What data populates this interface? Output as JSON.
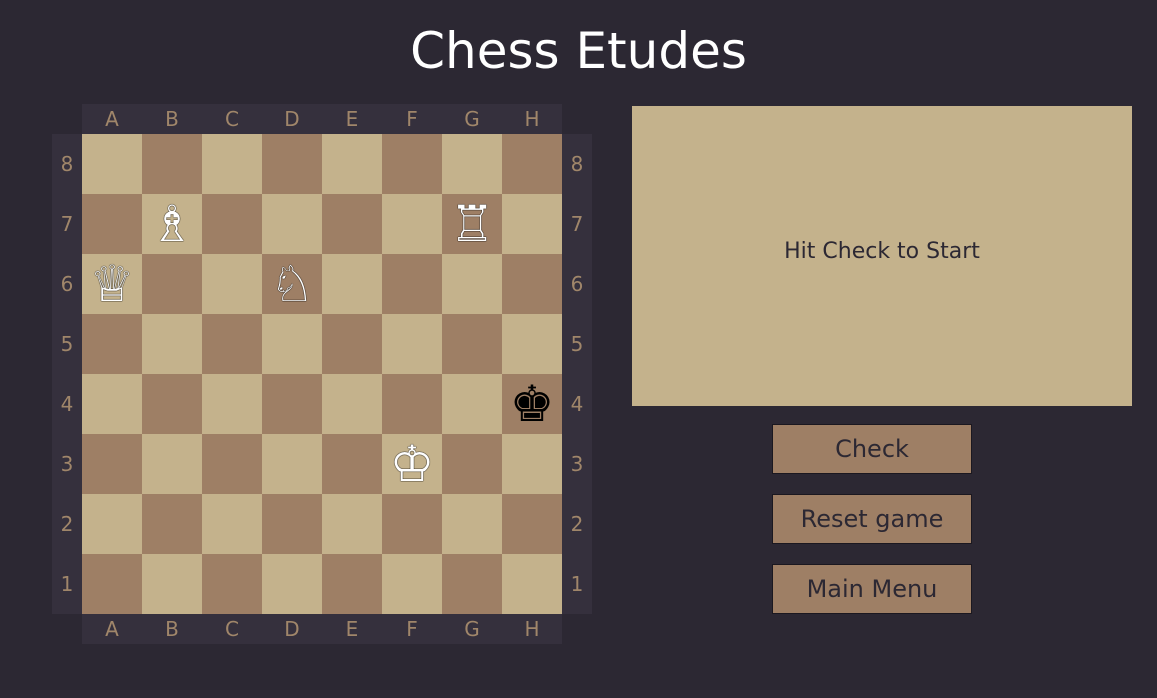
{
  "title": "Chess Etudes",
  "board": {
    "files": [
      "A",
      "B",
      "C",
      "D",
      "E",
      "F",
      "G",
      "H"
    ],
    "ranks": [
      "8",
      "7",
      "6",
      "5",
      "4",
      "3",
      "2",
      "1"
    ],
    "light_color": "#c4b28c",
    "dark_color": "#9e7f65",
    "pieces": [
      {
        "square": "b7",
        "color": "white",
        "type": "bishop",
        "glyph": "♗"
      },
      {
        "square": "g7",
        "color": "white",
        "type": "rook",
        "glyph": "♖"
      },
      {
        "square": "a6",
        "color": "white",
        "type": "queen",
        "glyph": "♕"
      },
      {
        "square": "d6",
        "color": "white",
        "type": "knight",
        "glyph": "♘"
      },
      {
        "square": "h4",
        "color": "black",
        "type": "king",
        "glyph": "♚"
      },
      {
        "square": "f3",
        "color": "white",
        "type": "king",
        "glyph": "♔"
      }
    ]
  },
  "message": "Hit Check to Start",
  "buttons": {
    "check": "Check",
    "reset": "Reset game",
    "main_menu": "Main Menu"
  },
  "colors": {
    "background": "#2c2833",
    "coordinate_text": "#a0866a",
    "button": "#9e7f65"
  }
}
